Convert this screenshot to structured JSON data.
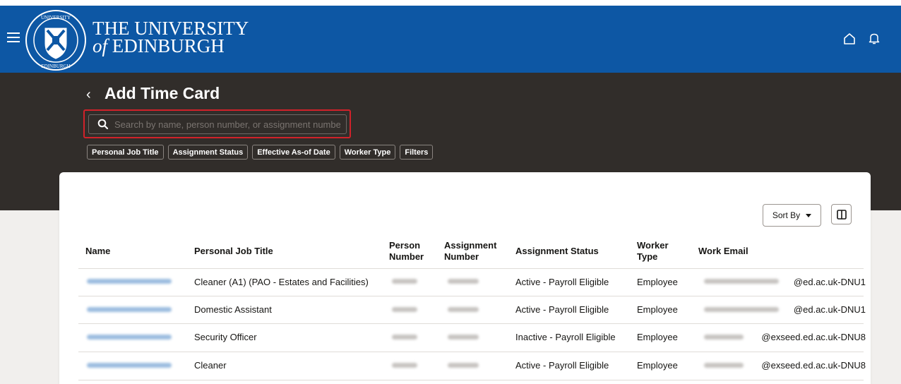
{
  "header": {
    "brand_line1": "THE UNIVERSITY",
    "brand_line2_prefix": "of",
    "brand_line2_rest": " EDINBURGH",
    "accent": "#0d57a4"
  },
  "page": {
    "title": "Add Time Card",
    "back_glyph": "‹"
  },
  "search": {
    "placeholder": "Search by name, person number, or assignment number",
    "value": ""
  },
  "filters": [
    "Personal Job Title",
    "Assignment Status",
    "Effective As-of Date",
    "Worker Type",
    "Filters"
  ],
  "toolbar": {
    "sort_label": "Sort By"
  },
  "table": {
    "headers": {
      "name": "Name",
      "job_title": "Personal Job Title",
      "person_number_1": "Person",
      "person_number_2": "Number",
      "assignment_number_1": "Assignment",
      "assignment_number_2": "Number",
      "assignment_status": "Assignment Status",
      "worker_type_1": "Worker",
      "worker_type_2": "Type",
      "work_email": "Work Email"
    },
    "rows": [
      {
        "job_title": "Cleaner (A1) (PAO - Estates and Facilities)",
        "assignment_status": "Active - Payroll Eligible",
        "worker_type": "Employee",
        "email_domain": "@ed.ac.uk-DNU1"
      },
      {
        "job_title": "Domestic Assistant",
        "assignment_status": "Active - Payroll Eligible",
        "worker_type": "Employee",
        "email_domain": "@ed.ac.uk-DNU1"
      },
      {
        "job_title": "Security Officer",
        "assignment_status": "Inactive - Payroll Eligible",
        "worker_type": "Employee",
        "email_domain": "@exseed.ed.ac.uk-DNU8"
      },
      {
        "job_title": "Cleaner",
        "assignment_status": "Active - Payroll Eligible",
        "worker_type": "Employee",
        "email_domain": "@exseed.ed.ac.uk-DNU8"
      }
    ]
  }
}
